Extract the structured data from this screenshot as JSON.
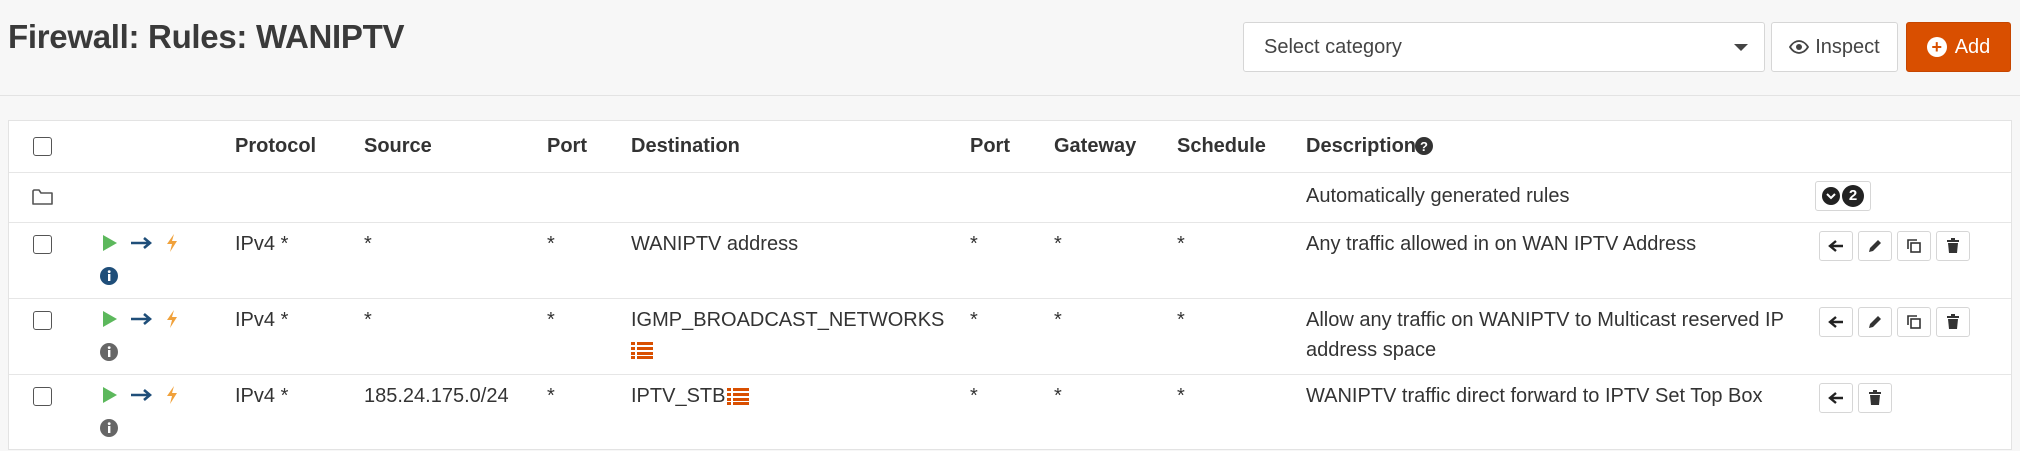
{
  "header": {
    "title": "Firewall: Rules: WANIPTV",
    "category_placeholder": "Select category",
    "inspect_label": "Inspect",
    "add_label": "Add"
  },
  "table": {
    "columns": [
      "Protocol",
      "Source",
      "Port",
      "Destination",
      "Port",
      "Gateway",
      "Schedule",
      "Description"
    ],
    "auto_group": {
      "description": "Automatically generated rules",
      "count": "2"
    },
    "rules": [
      {
        "protocol": "IPv4 *",
        "source": "*",
        "source_port": "*",
        "destination": "WANIPTV address",
        "dest_port": "*",
        "gateway": "*",
        "schedule": "*",
        "description": "Any traffic allowed in on WAN IPTV Address"
      },
      {
        "protocol": "IPv4 *",
        "source": "*",
        "source_port": "*",
        "destination": "IGMP_BROADCAST_NETWORKS",
        "dest_port": "*",
        "gateway": "*",
        "schedule": "*",
        "description_line1": "Allow any traffic on WANIPTV to Multicast reserved IP",
        "description_line2": "address space"
      },
      {
        "protocol": "IPv4 *",
        "source": "185.24.175.0/24",
        "source_port": "*",
        "destination": "IPTV_STB",
        "dest_port": "*",
        "gateway": "*",
        "schedule": "*",
        "description": "WANIPTV traffic direct forward to IPTV Set Top Box"
      }
    ]
  },
  "colors": {
    "accent": "#d94f00",
    "pass_green": "#5cb85c",
    "direction_blue": "#1f4e79",
    "info_blue": "#1f4e79",
    "alias_orange": "#d94f00"
  },
  "icons": [
    "eye-icon",
    "plus-circle-icon",
    "folder-icon",
    "help-icon",
    "chevron-down-icon",
    "play-icon",
    "arrow-right-icon",
    "bolt-icon",
    "info-icon",
    "list-icon",
    "arrow-left-icon",
    "pencil-icon",
    "copy-icon",
    "trash-icon"
  ]
}
